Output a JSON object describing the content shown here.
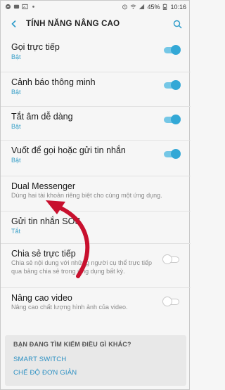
{
  "status_bar": {
    "battery": "45%",
    "time": "10:16"
  },
  "header": {
    "title": "TÍNH NĂNG NÂNG CAO"
  },
  "settings": [
    {
      "title": "Gọi trực tiếp",
      "subtitle": "Bật",
      "toggle": "on"
    },
    {
      "title": "Cảnh báo thông minh",
      "subtitle": "Bật",
      "toggle": "on"
    },
    {
      "title": "Tắt âm dễ dàng",
      "subtitle": "Bật",
      "toggle": "on"
    },
    {
      "title": "Vuốt để gọi hoặc gửi tin nhắn",
      "subtitle": "Bật",
      "toggle": "on"
    },
    {
      "title": "Dual Messenger",
      "description": "Dùng hai tài khoản riêng biệt cho cùng một ứng dụng."
    },
    {
      "title": "Gửi tin nhắn SOS",
      "subtitle": "Tắt"
    },
    {
      "title": "Chia sẻ trực tiếp",
      "description": "Chia sẻ nội dung với những người cụ thể trực tiếp qua bảng chia sẻ trong ứng dụng bất kỳ.",
      "toggle": "off"
    },
    {
      "title": "Nâng cao video",
      "description": "Nâng cao chất lượng hình ảnh của video.",
      "toggle": "off"
    }
  ],
  "suggestions": {
    "heading": "BẠN ĐANG TÌM KIẾM ĐIỀU GÌ KHÁC?",
    "links": [
      "SMART SWITCH",
      "CHẾ ĐỘ ĐƠN GIẢN"
    ]
  },
  "colors": {
    "accent": "#33a8d6",
    "link": "#2a8fc2",
    "arrow": "#c8102e"
  }
}
